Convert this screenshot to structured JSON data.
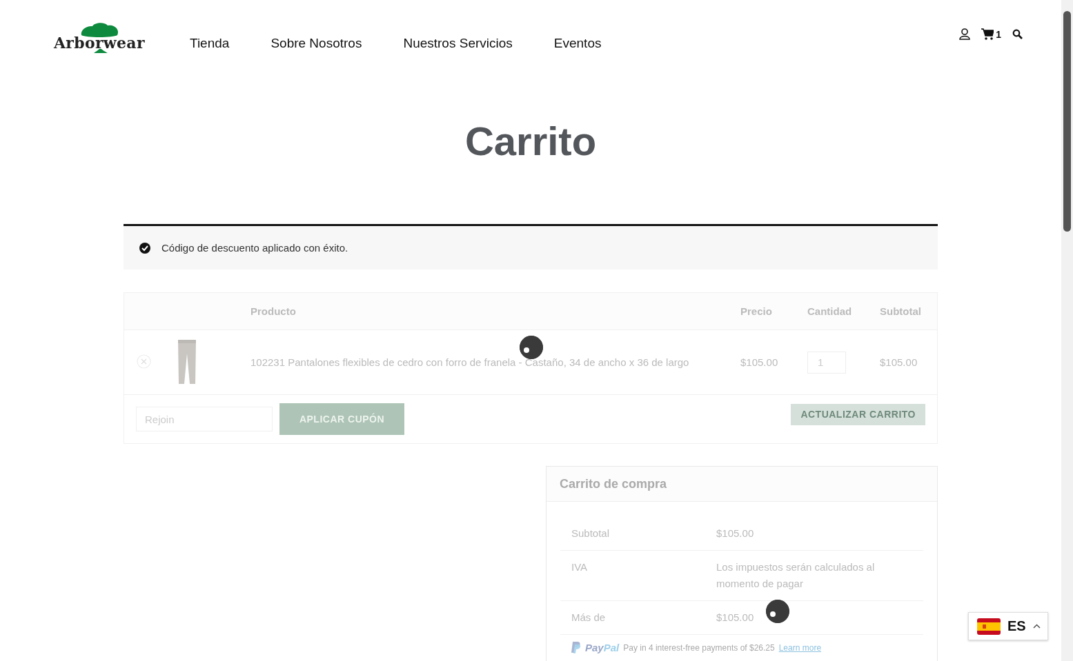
{
  "header": {
    "logo": "Arborwear",
    "nav": [
      {
        "label": "Tienda"
      },
      {
        "label": "Sobre Nosotros"
      },
      {
        "label": "Nuestros Servicios"
      },
      {
        "label": "Eventos"
      }
    ],
    "cart_count": "1"
  },
  "page_title": "Carrito",
  "notice": "Código de descuento aplicado con éxito.",
  "cart_table": {
    "columns": [
      "Producto",
      "Precio",
      "Cantidad",
      "Subtotal"
    ],
    "rows": [
      {
        "sku": "102231",
        "name": "Pantalones flexibles de cedro con forro de franela - Castaño, 34 de ancho x 36 de largo",
        "price": "$105.00",
        "quantity": "1",
        "subtotal": "$105.00"
      }
    ]
  },
  "coupon": {
    "value": "Rejoin",
    "apply_button": "APLICAR CUPÓN",
    "update_button": "ACTUALIZAR CARRITO"
  },
  "totals": {
    "title": "Carrito de compra",
    "rows": [
      {
        "label": "Subtotal",
        "value": "$105.00"
      },
      {
        "label": "IVA",
        "value": "Los impuestos serán calculados al momento de pagar"
      },
      {
        "label": "Más de",
        "value": "$105.00"
      }
    ],
    "paypal": {
      "brand_left": "Pay",
      "brand_right": "Pal",
      "message": "Pay in 4 interest-free payments of $26.25",
      "link": "Learn more"
    }
  },
  "language": {
    "code": "ES"
  }
}
